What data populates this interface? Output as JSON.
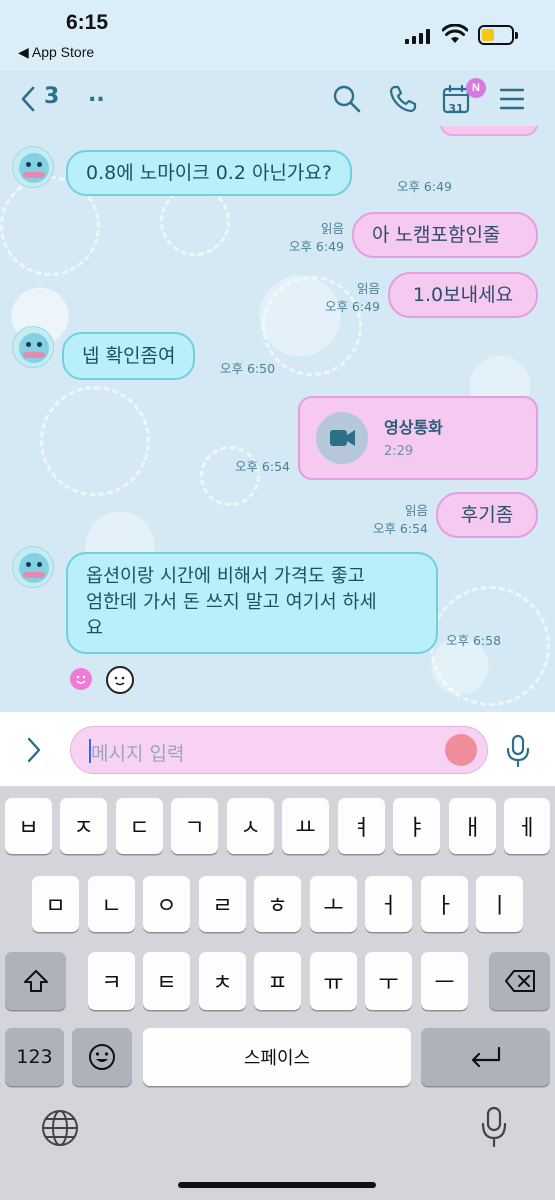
{
  "status_bar": {
    "time": "6:15",
    "back_app": "◀ App Store"
  },
  "header": {
    "member_count": "3",
    "name": "..",
    "calendar_day": "31",
    "calendar_badge": "N"
  },
  "messages": [
    {
      "text": "0.8에 노마이크 0.2 아닌가요?",
      "time": "오후 6:49"
    },
    {
      "text": "아 노캠포함인줄",
      "read": "읽음",
      "time": "오후 6:49"
    },
    {
      "text": "1.0보내세요",
      "read": "읽음",
      "time": "오후 6:49"
    },
    {
      "text": "넵 확인좀여",
      "time": "오후 6:50"
    },
    {
      "title": "영상통화",
      "duration": "2:29",
      "time": "오후 6:54"
    },
    {
      "text": "후기좀",
      "read": "읽음",
      "time": "오후 6:54"
    },
    {
      "line1": "옵션이랑 시간에 비해서 가격도 좋고",
      "line2": "엄한데 가서 돈 쓰지 말고 여기서 하세",
      "line3": "요",
      "time": "오후 6:58"
    }
  ],
  "input": {
    "placeholder": "메시지 입력"
  },
  "keyboard": {
    "row1": [
      "ㅂ",
      "ㅈ",
      "ㄷ",
      "ㄱ",
      "ㅅ",
      "ㅛ",
      "ㅕ",
      "ㅑ",
      "ㅐ",
      "ㅔ"
    ],
    "row2": [
      "ㅁ",
      "ㄴ",
      "ㅇ",
      "ㄹ",
      "ㅎ",
      "ㅗ",
      "ㅓ",
      "ㅏ",
      "ㅣ"
    ],
    "row3": [
      "ㅋ",
      "ㅌ",
      "ㅊ",
      "ㅍ",
      "ㅠ",
      "ㅜ",
      "ㅡ"
    ],
    "numbers_key": "123",
    "space_key": "스페이스"
  },
  "colors": {
    "accent": "#2b6f8a",
    "incoming_bubble": "#b9eff8",
    "outgoing_bubble": "#f6c9f1",
    "badge": "#d77adf"
  }
}
